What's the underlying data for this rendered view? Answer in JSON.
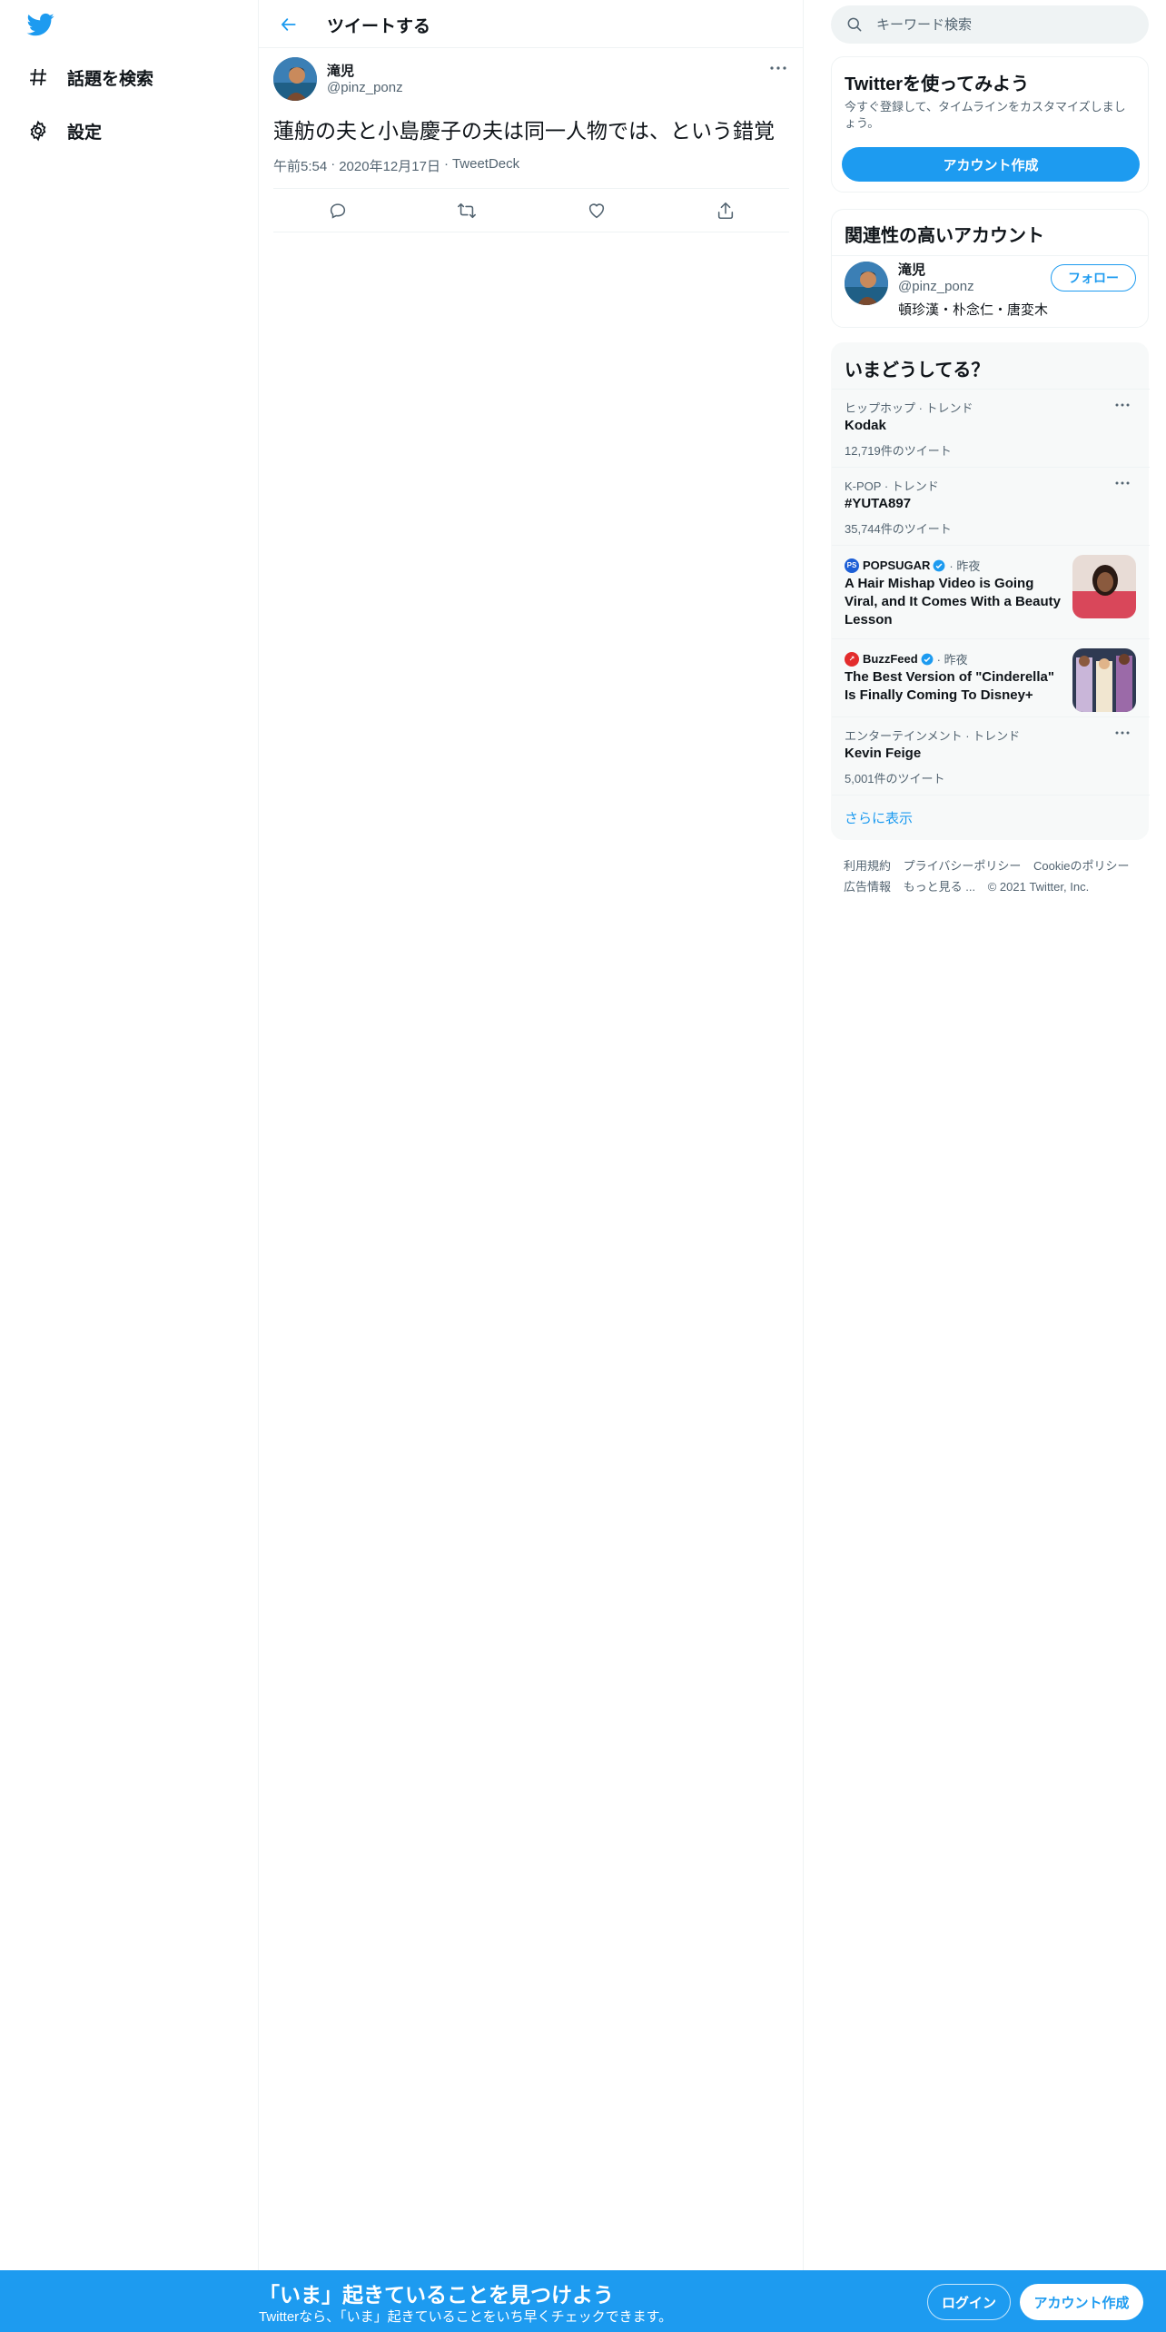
{
  "colors": {
    "accent": "#1d9bf0",
    "text": "#0f1419",
    "muted": "#536471",
    "border": "#eff3f4",
    "panel": "#f7f9f9"
  },
  "nav": {
    "logo_icon": "twitter-bird-icon",
    "items": [
      {
        "icon": "hashtag-icon",
        "label": "話題を検索"
      },
      {
        "icon": "gear-icon",
        "label": "設定"
      }
    ]
  },
  "header": {
    "back_icon": "back-arrow-icon",
    "title": "ツイートする"
  },
  "tweet": {
    "author_name": "滝児",
    "author_handle": "@pinz_ponz",
    "text": "蓮舫の夫と小島慶子の夫は同一人物では、という錯覚",
    "time": "午前5:54",
    "date": "2020年12月17日",
    "source": "TweetDeck",
    "dot": "·",
    "actions": [
      "reply-icon",
      "retweet-icon",
      "like-icon",
      "share-icon"
    ]
  },
  "search": {
    "placeholder": "キーワード検索"
  },
  "signup": {
    "title": "Twitterを使ってみよう",
    "description": "今すぐ登録して、タイムラインをカスタマイズしましょう。",
    "button": "アカウント作成"
  },
  "related": {
    "title": "関連性の高いアカウント",
    "name": "滝児",
    "handle": "@pinz_ponz",
    "bio": "頓珍漢・朴念仁・唐変木",
    "follow": "フォロー"
  },
  "trends": {
    "title": "いまどうしてる？",
    "items": [
      {
        "context": "ヒップホップ · トレンド",
        "name": "Kodak",
        "count": "12,719件のツイート"
      },
      {
        "context": "K-POP · トレンド",
        "name": "#YUTA897",
        "count": "35,744件のツイート"
      },
      {
        "context": "エンターテインメント · トレンド",
        "name": "Kevin Feige",
        "count": "5,001件のツイート"
      }
    ],
    "news": [
      {
        "source": "POPSUGAR",
        "time": "· 昨夜",
        "headline": "A Hair Mishap Video is Going Viral, and It Comes With a Beauty Lesson"
      },
      {
        "source": "BuzzFeed",
        "time": "· 昨夜",
        "headline": "The Best Version of \"Cinderella\" Is Finally Coming To Disney+"
      }
    ],
    "show_more": "さらに表示"
  },
  "footer": {
    "links": [
      "利用規約",
      "プライバシーポリシー",
      "Cookieのポリシー",
      "広告情報",
      "もっと見る ...",
      "© 2021 Twitter, Inc."
    ]
  },
  "bottom_bar": {
    "title": "「いま」起きていることを見つけよう",
    "subtitle": "Twitterなら、「いま」起きていることをいち早くチェックできます。",
    "login": "ログイン",
    "signup": "アカウント作成"
  }
}
